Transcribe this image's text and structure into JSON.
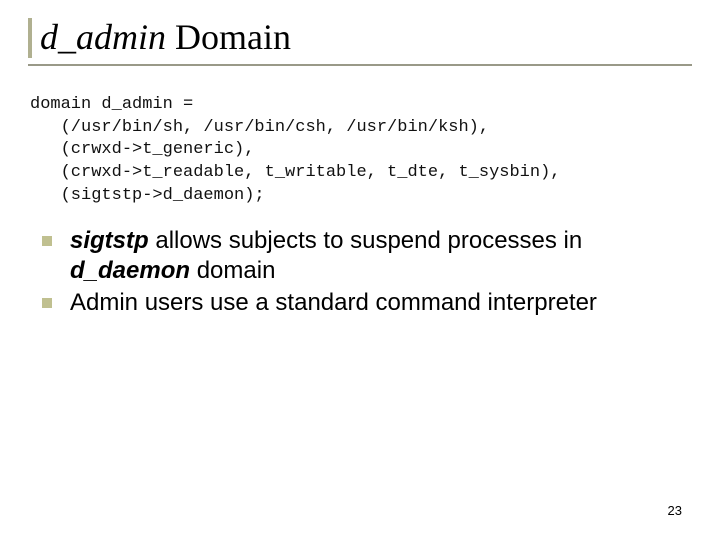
{
  "title": {
    "italic_part": "d_admin",
    "rest": " Domain"
  },
  "code": {
    "line1": "domain d_admin =",
    "line2": "   (/usr/bin/sh, /usr/bin/csh, /usr/bin/ksh),",
    "line3": "   (crwxd->t_generic),",
    "line4": "   (crwxd->t_readable, t_writable, t_dte, t_sysbin),",
    "line5": "   (sigtstp->d_daemon);"
  },
  "bullets": [
    {
      "runs": [
        {
          "text": "sigtstp",
          "style": "bi"
        },
        {
          "text": " allows subjects to suspend processes in ",
          "style": ""
        },
        {
          "text": "d_daemon",
          "style": "bi"
        },
        {
          "text": " domain",
          "style": ""
        }
      ]
    },
    {
      "runs": [
        {
          "text": "Admin users use a standard command interpreter",
          "style": ""
        }
      ]
    }
  ],
  "page_number": "23"
}
